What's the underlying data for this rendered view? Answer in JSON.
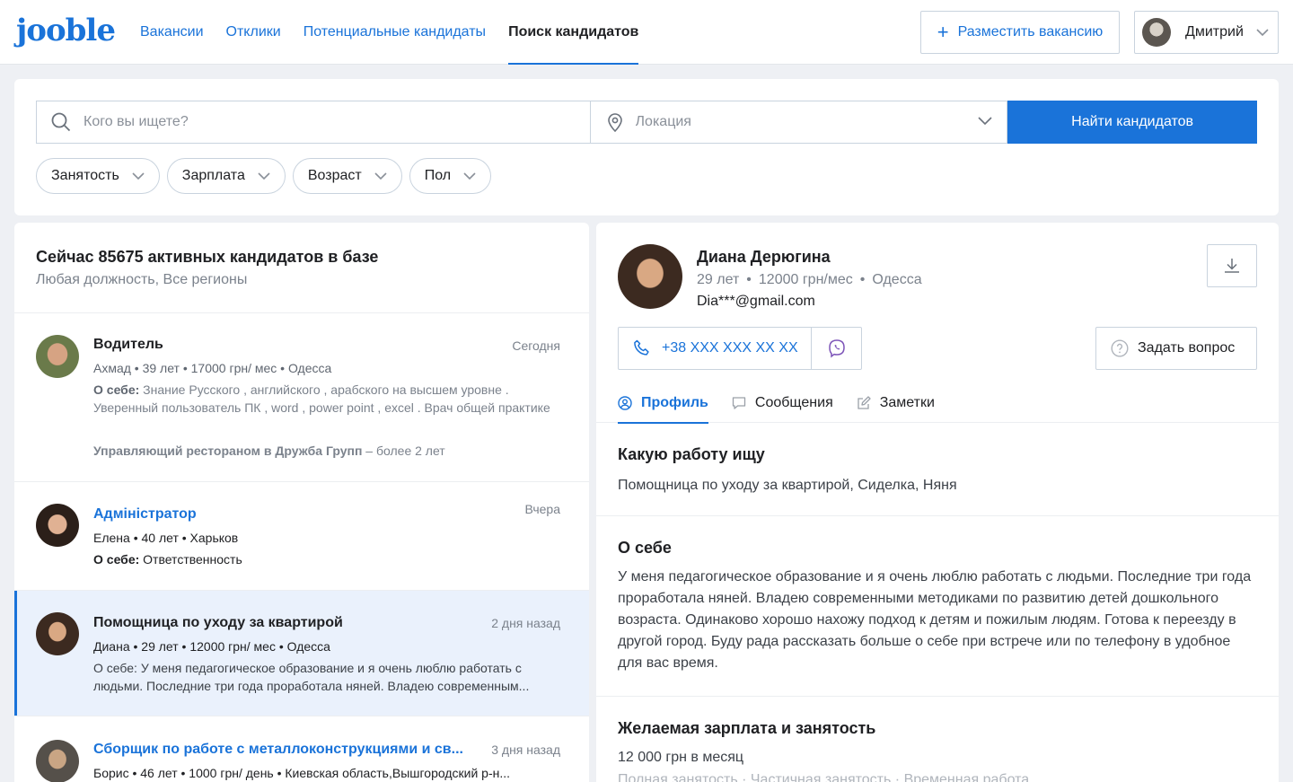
{
  "header": {
    "logo": "jooble",
    "nav": [
      {
        "label": "Вакансии",
        "active": false
      },
      {
        "label": "Отклики",
        "active": false
      },
      {
        "label": "Потенциальные кандидаты",
        "active": false
      },
      {
        "label": "Поиск кандидатов",
        "active": true
      }
    ],
    "post_button": "Разместить вакансию",
    "user_name": "Дмитрий"
  },
  "search": {
    "query_placeholder": "Кого вы ищете?",
    "location_placeholder": "Локация",
    "button": "Найти кандидатов",
    "filters": [
      "Занятость",
      "Зарплата",
      "Возраст",
      "Пол"
    ]
  },
  "list": {
    "title": "Сейчас 85675 активных кандидатов в базе",
    "subtitle": "Любая должность, Все регионы",
    "about_label": "О себе:",
    "candidates": [
      {
        "title": "Водитель",
        "date": "Сегодня",
        "meta": "Ахмад  •  39 лет  •  17000 грн/ мес  •  Одесса",
        "about": " Знание Русского , английского , арабского на высшем уровне . Уверенный пользователь ПК , word , power point , excel . Врач общей практике",
        "exp_company": "Управляющий рестораном в Дружба Групп",
        "exp_duration": " – более 2 лет"
      },
      {
        "title": "Адміністратор",
        "date": "Вчера",
        "meta": "Елена  •  40 лет  •  Харьков",
        "about": " Ответственность"
      },
      {
        "title": "Помощница по уходу за квартирой",
        "date": "2 дня назад",
        "meta": "Диана  •  29 лет  • 12000 грн/ мес •  Одесса",
        "about": "О себе: У меня педагогическое образование и я очень люблю работать с людьми. Последние три года проработала няней. Владею современным..."
      },
      {
        "title": "Сборщик по работе с металлоконструкциями и св...",
        "date": "3 дня назад",
        "meta": "Борис •  46 лет  • 1000 грн/ день •  Киевская область,Вышгородский р-н..."
      }
    ]
  },
  "profile": {
    "name": "Диана Дерюгина",
    "age": "29 лет",
    "salary": "12000 грн/мес",
    "city": "Одесса",
    "email": "Dia***@gmail.com",
    "phone": "+38 XXX XXX XX XX",
    "ask_button": "Задать вопрос",
    "tabs": [
      "Профиль",
      "Сообщения",
      "Заметки"
    ],
    "sections": {
      "looking_title": "Какую работу ищу",
      "looking_text": "Помощница по уходу за квартирой, Сиделка, Няня",
      "about_title": "О себе",
      "about_text": "У меня педагогическое образование и я очень люблю работать с людьми. Последние три года проработала няней. Владею современными методиками по развитию детей дошкольного возраста. Одинаково хорошо нахожу подход к детям и пожилым людям. Готова к переезду в другой город. Буду рада рассказать больше о себе при встрече или по телефону в удобное для вас время.",
      "salary_title": "Желаемая зарплата и занятость",
      "salary_text": "12 000 грн в месяц",
      "employment_text": "Полная занятость  ·  Частичная занятость  ·  Временная работа"
    }
  },
  "colors": {
    "accent": "#1a73d9",
    "selected_bg": "#eaf1fc",
    "background": "#eef0f4"
  }
}
